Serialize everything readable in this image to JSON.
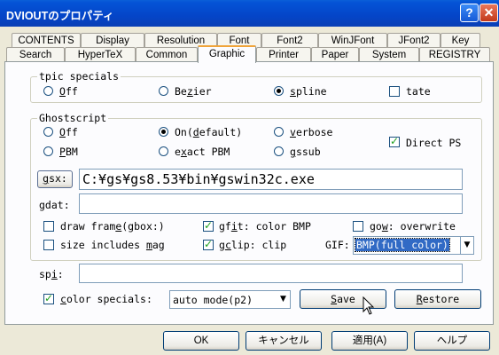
{
  "window": {
    "title": "DVIOUTのプロパティ"
  },
  "tabs_row_top": [
    "CONTENTS",
    "Display",
    "Resolution",
    "Font",
    "Font2",
    "WinJFont",
    "JFont2",
    "Key"
  ],
  "tabs_row_bottom": [
    "Search",
    "HyperTeX",
    "Common",
    "Graphic",
    "Printer",
    "Paper",
    "System",
    "REGISTRY"
  ],
  "active_tab": "Graphic",
  "tpic": {
    "legend": "tpic specials",
    "options": [
      "Off",
      "Bezier",
      "spline",
      "tate"
    ],
    "selected": "spline",
    "tate_checked": false
  },
  "ghostscript": {
    "legend": "Ghostscript",
    "row1": [
      "Off",
      "On(default)",
      "verbose"
    ],
    "row2": [
      "PBM",
      "exact PBM",
      "gssub"
    ],
    "selected": "On(default)",
    "direct_ps_label": "Direct PS",
    "direct_ps_checked": true,
    "gsx_button": "gsx:",
    "gsx_value": "C:¥gs¥gs8.53¥bin¥gswin32c.exe",
    "gdat_label": "gdat:",
    "gdat_value": "",
    "draw_frame_label": "draw frame(gbox:)",
    "gfit_label": "gfit: color BMP",
    "gow_label": "gow: overwrite",
    "size_mag_label": "size includes mag",
    "gclip_label": "gclip: clip",
    "gif_label": "GIF:",
    "gif_value": "BMP(full color)",
    "draw_frame_checked": false,
    "gfit_checked": true,
    "gow_checked": false,
    "size_mag_checked": false,
    "gclip_checked": true
  },
  "spi": {
    "label": "spi:",
    "value": ""
  },
  "color_specials": {
    "label": "color specials:",
    "checked": true,
    "value": "auto mode(p2)"
  },
  "buttons": {
    "save": "Save",
    "restore": "Restore"
  },
  "footer": {
    "ok": "OK",
    "cancel": "キャンセル",
    "apply": "適用(A)",
    "help": "ヘルプ"
  }
}
